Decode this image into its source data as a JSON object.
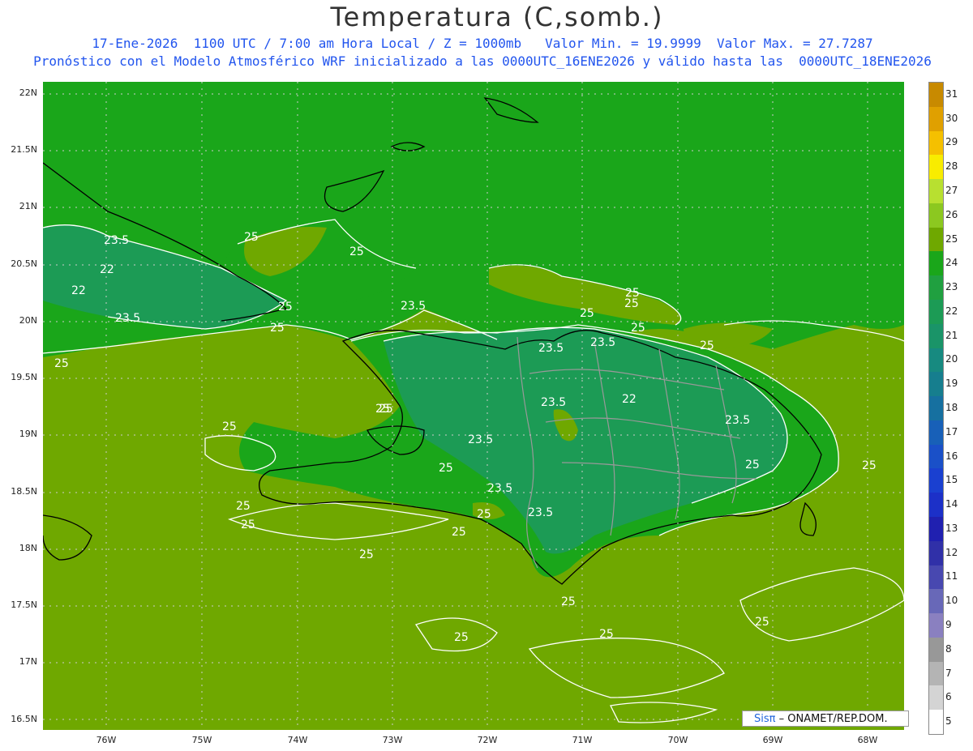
{
  "title": "Temperatura (C,somb.)",
  "subtitle1": "17-Ene-2026  1100 UTC / 7:00 am Hora Local / Z = 1000mb   Valor Min. = 19.9999  Valor Max. = 27.7287",
  "subtitle2": "Pronóstico con el Modelo Atmosférico WRF inicializado a las 0000UTC_16ENE2026 y válido hasta las  0000UTC_18ENE2026",
  "y_ticks": [
    "22N",
    "21.5N",
    "21N",
    "20.5N",
    "20N",
    "19.5N",
    "19N",
    "18.5N",
    "18N",
    "17.5N",
    "17N",
    "16.5N"
  ],
  "x_ticks": [
    "76W",
    "75W",
    "74W",
    "73W",
    "72W",
    "71W",
    "70W",
    "69W",
    "68W"
  ],
  "contour_labels": [
    "23.5",
    "22",
    "22",
    "23.5",
    "25",
    "25",
    "25",
    "25",
    "25",
    "25",
    "25",
    "23.5",
    "23.5",
    "23.5",
    "22",
    "23.5",
    "23.5",
    "23.5",
    "23.5",
    "23.5",
    "25",
    "25",
    "25",
    "25",
    "25",
    "25",
    "25",
    "25",
    "25",
    "25",
    "25",
    "25",
    "25",
    "25",
    "25",
    "25",
    "25",
    "25"
  ],
  "colorbar": {
    "labels": [
      "31",
      "30",
      "29",
      "28",
      "27",
      "26",
      "25",
      "24",
      "23",
      "22",
      "21",
      "20",
      "19",
      "18",
      "17",
      "16",
      "15",
      "14",
      "13",
      "12",
      "11",
      "10",
      "9",
      "8",
      "7",
      "6",
      "5"
    ],
    "colors": [
      "#c88a00",
      "#e0a000",
      "#f5c000",
      "#f8ec00",
      "#b8e030",
      "#8cc820",
      "#6fa800",
      "#1aa61a",
      "#20a040",
      "#1c9b55",
      "#1a9468",
      "#178a80",
      "#167e8e",
      "#1670a0",
      "#1860b8",
      "#1a50c8",
      "#1a40d0",
      "#1c30c8",
      "#2020b0",
      "#3030a8",
      "#4848b0",
      "#6868b8",
      "#8a80c0",
      "#989898",
      "#b4b4b4",
      "#d4d4d4",
      "#ffffff"
    ]
  },
  "credit": {
    "brand": "Sisπ",
    "text": "– ONAMET/REP.DOM."
  },
  "colors": {
    "base": "#6fa800",
    "land": "#1aa61a",
    "deep": "#1c9b55",
    "coast": "#000000",
    "borders": "#999999",
    "contour": "#ffffff"
  }
}
